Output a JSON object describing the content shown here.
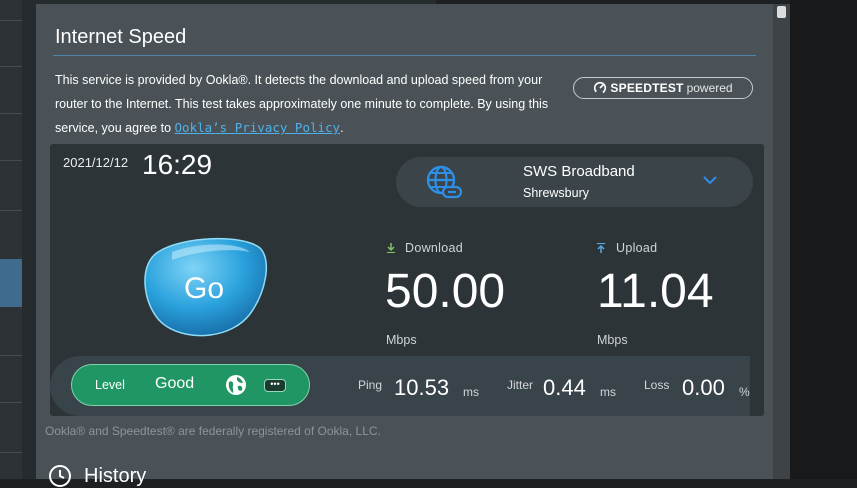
{
  "header": {
    "title": "Internet Speed"
  },
  "description": {
    "text": "This service is provided by Ookla®. It detects the download and upload speed from your router to the Internet. This test takes approximately one minute to complete. By using this service, you agree to ",
    "link_text": "Ookla’s Privacy Policy",
    "suffix": "."
  },
  "badge": {
    "brand": "SPEEDTEST",
    "powered": "powered"
  },
  "clock": {
    "date": "2021/12/12",
    "time": "16:29"
  },
  "server": {
    "name": "SWS Broadband",
    "city": "Shrewsbury",
    "icon": "globe-link-icon"
  },
  "go_button": {
    "label": "Go"
  },
  "download": {
    "label": "Download",
    "value": "50.00",
    "unit": "Mbps"
  },
  "upload": {
    "label": "Upload",
    "value": "11.04",
    "unit": "Mbps"
  },
  "level": {
    "label": "Level",
    "value": "Good",
    "more": "•••"
  },
  "ping": {
    "label": "Ping",
    "value": "10.53",
    "unit": "ms"
  },
  "jitter": {
    "label": "Jitter",
    "value": "0.44",
    "unit": "ms"
  },
  "loss": {
    "label": "Loss",
    "value": "0.00",
    "unit": "%"
  },
  "footer": {
    "text": "Ookla® and Speedtest® are federally registered of Ookla, LLC."
  },
  "history": {
    "title": "History"
  },
  "colors": {
    "accent": "#4fb1ea",
    "panel": "#4a5257",
    "card": "#2d3438",
    "level_green": "#1f9663"
  }
}
